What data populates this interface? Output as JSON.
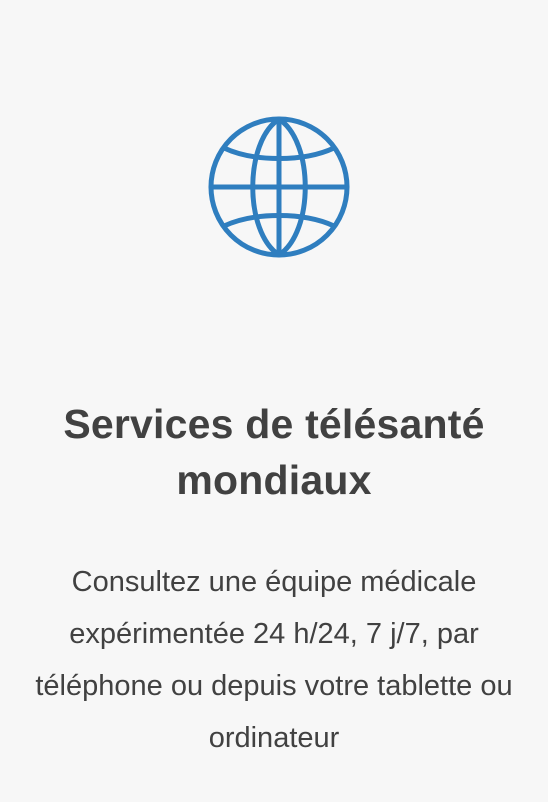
{
  "card": {
    "icon": "globe-icon",
    "accent_color": "#2f7ebf",
    "title": "Services de télésanté mondiaux",
    "description": "Consultez une équipe médicale expérimentée 24 h/24, 7 j/7, par téléphone ou depuis votre tablette ou ordinateur"
  }
}
